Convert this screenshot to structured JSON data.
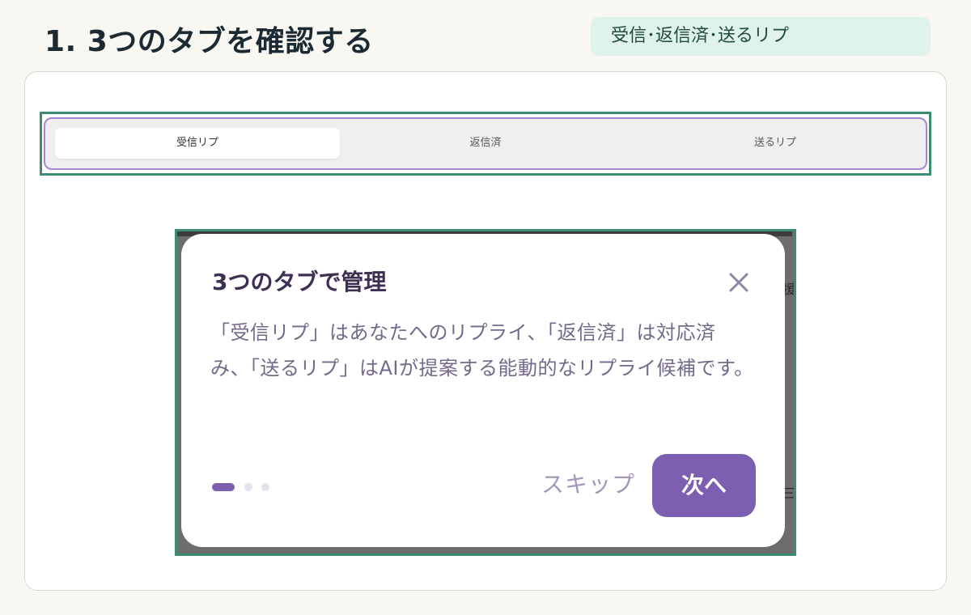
{
  "header": {
    "title": "1. 3つのタブを確認する",
    "badge": "受信･返信済･送るリプ"
  },
  "tabs_screenshot": {
    "tabs": [
      {
        "label": "受信リプ",
        "active": true
      },
      {
        "label": "返信済",
        "active": false
      },
      {
        "label": "送るリプ",
        "active": false
      }
    ]
  },
  "dialog_screenshot": {
    "background_fragments": [
      "援",
      "三"
    ],
    "title": "3つのタブで管理",
    "close_icon": "close-icon",
    "body": "「受信リプ」はあなたへのリプライ、「返信済」は対応済み、「送るリプ」はAIが提案する能動的なリプライ候補です。",
    "pager": {
      "total": 3,
      "current": 1
    },
    "skip_label": "スキップ",
    "next_label": "次へ"
  },
  "colors": {
    "accent_purple": "#7c5fb0",
    "frame_green": "#3d8c72",
    "badge_bg": "#e0f2ec"
  }
}
